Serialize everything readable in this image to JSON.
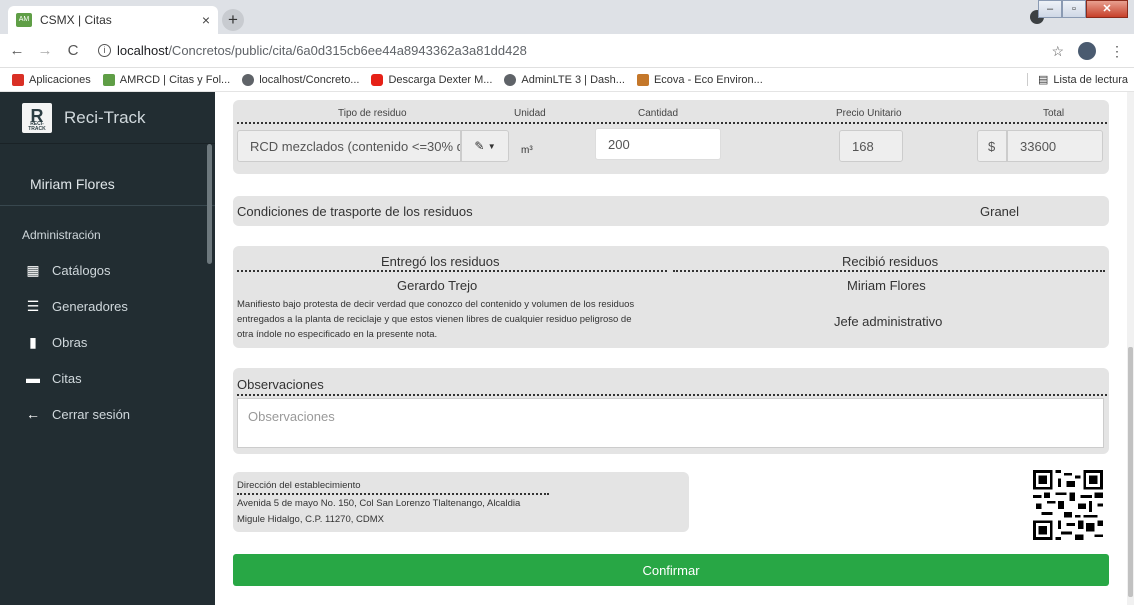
{
  "browser": {
    "tab_title": "CSMX | Citas",
    "tab_close": "×",
    "new_tab": "+",
    "url_host": "localhost",
    "url_path": "/Concretos/public/cita/6a0d315cb6ee44a8943362a3a81dd428",
    "bookmarks": [
      {
        "label": "Aplicaciones",
        "icon": "apps-icon",
        "color": "#d93025"
      },
      {
        "label": "AMRCD | Citas y Fol...",
        "icon": "amrcd-icon",
        "color": "#5f9e46"
      },
      {
        "label": "localhost/Concreto...",
        "icon": "globe-icon",
        "color": "#5f6368"
      },
      {
        "label": "Descarga Dexter M...",
        "icon": "youtube-icon",
        "color": "#e62117"
      },
      {
        "label": "AdminLTE 3 | Dash...",
        "icon": "globe-icon",
        "color": "#5f6368"
      },
      {
        "label": "Ecova - Eco Environ...",
        "icon": "ecova-icon",
        "color": "#c4772a"
      }
    ],
    "reading_list": "Lista de lectura"
  },
  "sidebar": {
    "brand": "Reci-Track",
    "logo_letter": "R",
    "logo_sub": "RECI-TRACK",
    "user": "Miriam Flores",
    "section": "Administración",
    "items": [
      {
        "label": "Catálogos",
        "icon": "table-icon"
      },
      {
        "label": "Generadores",
        "icon": "bars-icon"
      },
      {
        "label": "Obras",
        "icon": "building-icon"
      },
      {
        "label": "Citas",
        "icon": "calendar-icon"
      },
      {
        "label": "Cerrar sesión",
        "icon": "arrow-left-icon"
      }
    ]
  },
  "residuos": {
    "headers": {
      "tipo": "Tipo de residuo",
      "unidad": "Unidad",
      "cantidad": "Cantidad",
      "precio": "Precio Unitario",
      "total": "Total"
    },
    "tipo_value": "RCD mezclados (contenido <=30% d",
    "unidad_value": "m³",
    "cantidad_value": "200",
    "precio_value": "168",
    "currency": "$",
    "total_value": "33600"
  },
  "transporte": {
    "label": "Condiciones de trasporte de los residuos",
    "value": "Granel"
  },
  "entrega": {
    "entrego_label": "Entregó los residuos",
    "recibio_label": "Recibió residuos",
    "entrego_name": "Gerardo Trejo",
    "recibio_name": "Miriam Flores",
    "recibio_role": "Jefe administrativo",
    "manifiesto": [
      "Manifiesto bajo protesta de decir verdad que conozco del contenido y volumen de los residuos",
      "entregados a la planta de reciclaje y que estos vienen libres de cualquier residuo peligroso de",
      "otra índole no especificado en la presente nota."
    ]
  },
  "observaciones": {
    "label": "Observaciones",
    "placeholder": "Observaciones"
  },
  "direccion": {
    "label": "Dirección del establecimiento",
    "line1": "Avenida 5 de mayo No. 150, Col San Lorenzo Tlaltenango, Alcaldia",
    "line2": "Migule Hidalgo, C.P. 11270, CDMX"
  },
  "confirm_label": "Confirmar"
}
